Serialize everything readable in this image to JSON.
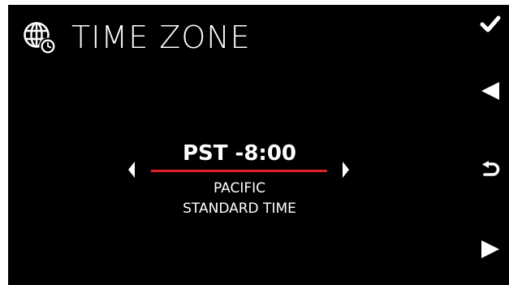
{
  "header": {
    "title": "TIME ZONE",
    "icon": "globe-clock-icon"
  },
  "selector": {
    "zone_code": "PST -8:00",
    "zone_name_line1": "PACIFIC",
    "zone_name_line2": "STANDARD TIME",
    "left_arrow_icon": "chevron-left-icon",
    "right_arrow_icon": "chevron-right-icon"
  },
  "side_buttons": [
    {
      "name": "confirm",
      "icon": "checkmark-icon"
    },
    {
      "name": "previous",
      "icon": "triangle-left-icon"
    },
    {
      "name": "back",
      "icon": "return-icon"
    },
    {
      "name": "next",
      "icon": "triangle-right-icon"
    }
  ],
  "colors": {
    "background": "#000000",
    "text": "#ffffff",
    "accent": "#e41f2a"
  }
}
